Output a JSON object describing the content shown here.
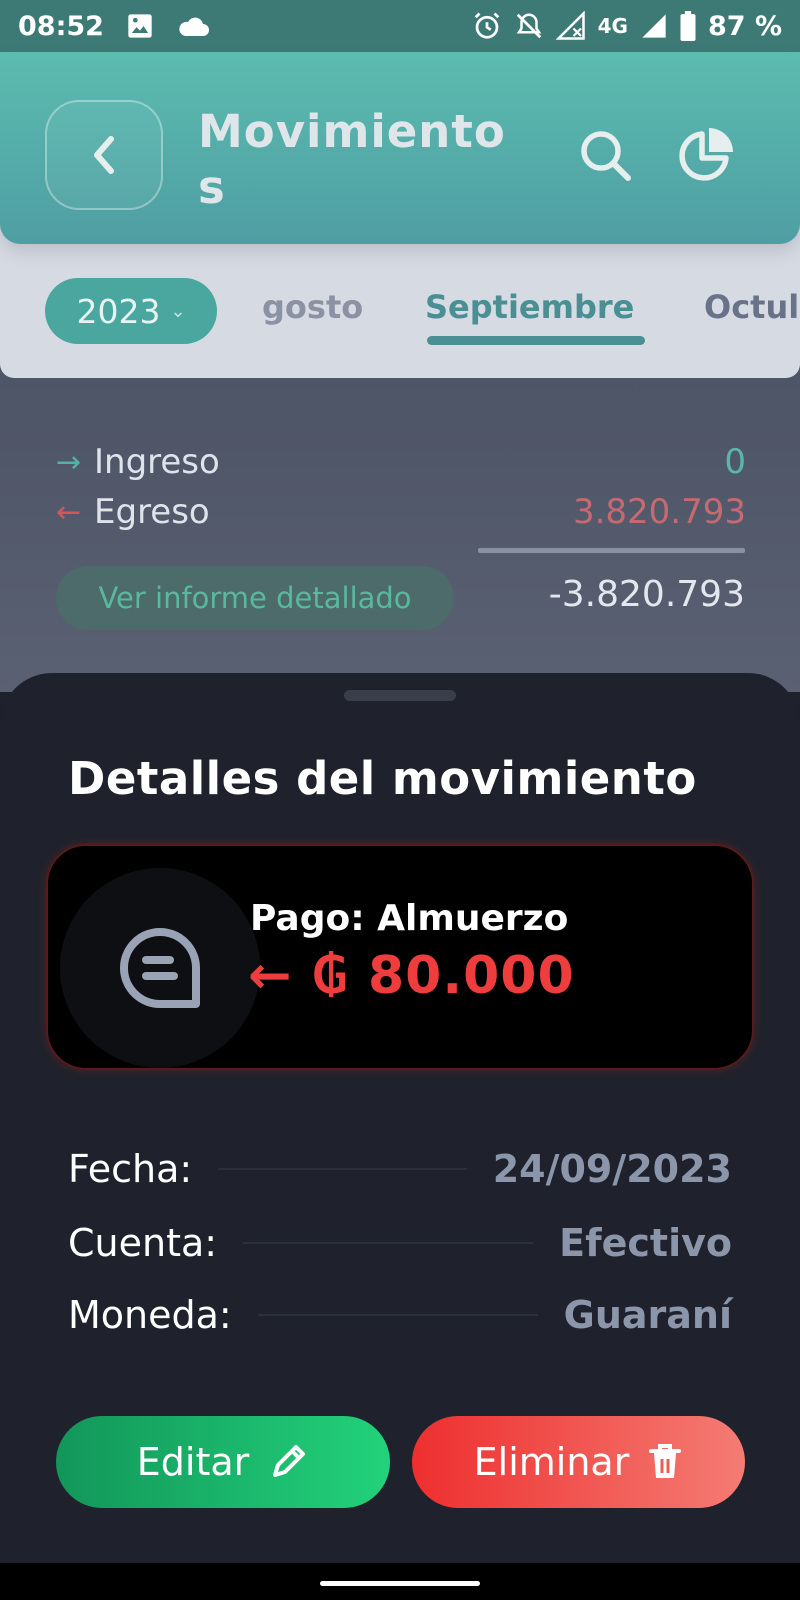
{
  "status_bar": {
    "time": "08:52",
    "network": "4G",
    "battery": "87 %",
    "icons": [
      "image-icon",
      "cloud-icon",
      "alarm-icon",
      "notifications-off-icon",
      "signal-off-icon",
      "signal-icon",
      "battery-icon"
    ]
  },
  "header": {
    "title": "Movimientos",
    "back_icon": "chevron-left-icon",
    "search_icon": "search-icon",
    "chart_icon": "pie-chart-icon"
  },
  "period": {
    "year": "2023",
    "tabs": [
      {
        "label": "gosto",
        "state": "previous"
      },
      {
        "label": "Septiembre",
        "state": "active"
      },
      {
        "label": "Octul",
        "state": "next"
      }
    ]
  },
  "summary": {
    "income_label": "Ingreso",
    "income_value": "0",
    "expense_label": "Egreso",
    "expense_value": "3.820.793",
    "report_button": "Ver informe detallado",
    "total": "-3.820.793"
  },
  "sheet": {
    "title": "Detalles del movimiento",
    "transaction": {
      "title": "Pago: Almuerzo",
      "amount": "← ₲ 80.000",
      "icon": "note-icon"
    },
    "details": [
      {
        "label": "Fecha:",
        "value": "24/09/2023"
      },
      {
        "label": "Cuenta:",
        "value": "Efectivo"
      },
      {
        "label": "Moneda:",
        "value": "Guaraní"
      }
    ],
    "edit_button": "Editar",
    "delete_button": "Eliminar"
  },
  "colors": {
    "header_gradient_start": "#5bbcb0",
    "header_gradient_end": "#4f9ea3",
    "income": "#58b7a9",
    "expense": "#ef3d3d",
    "edit_button": "#1cbd6b",
    "delete_button": "#ef3b35",
    "sheet_background": "#1f222c"
  }
}
